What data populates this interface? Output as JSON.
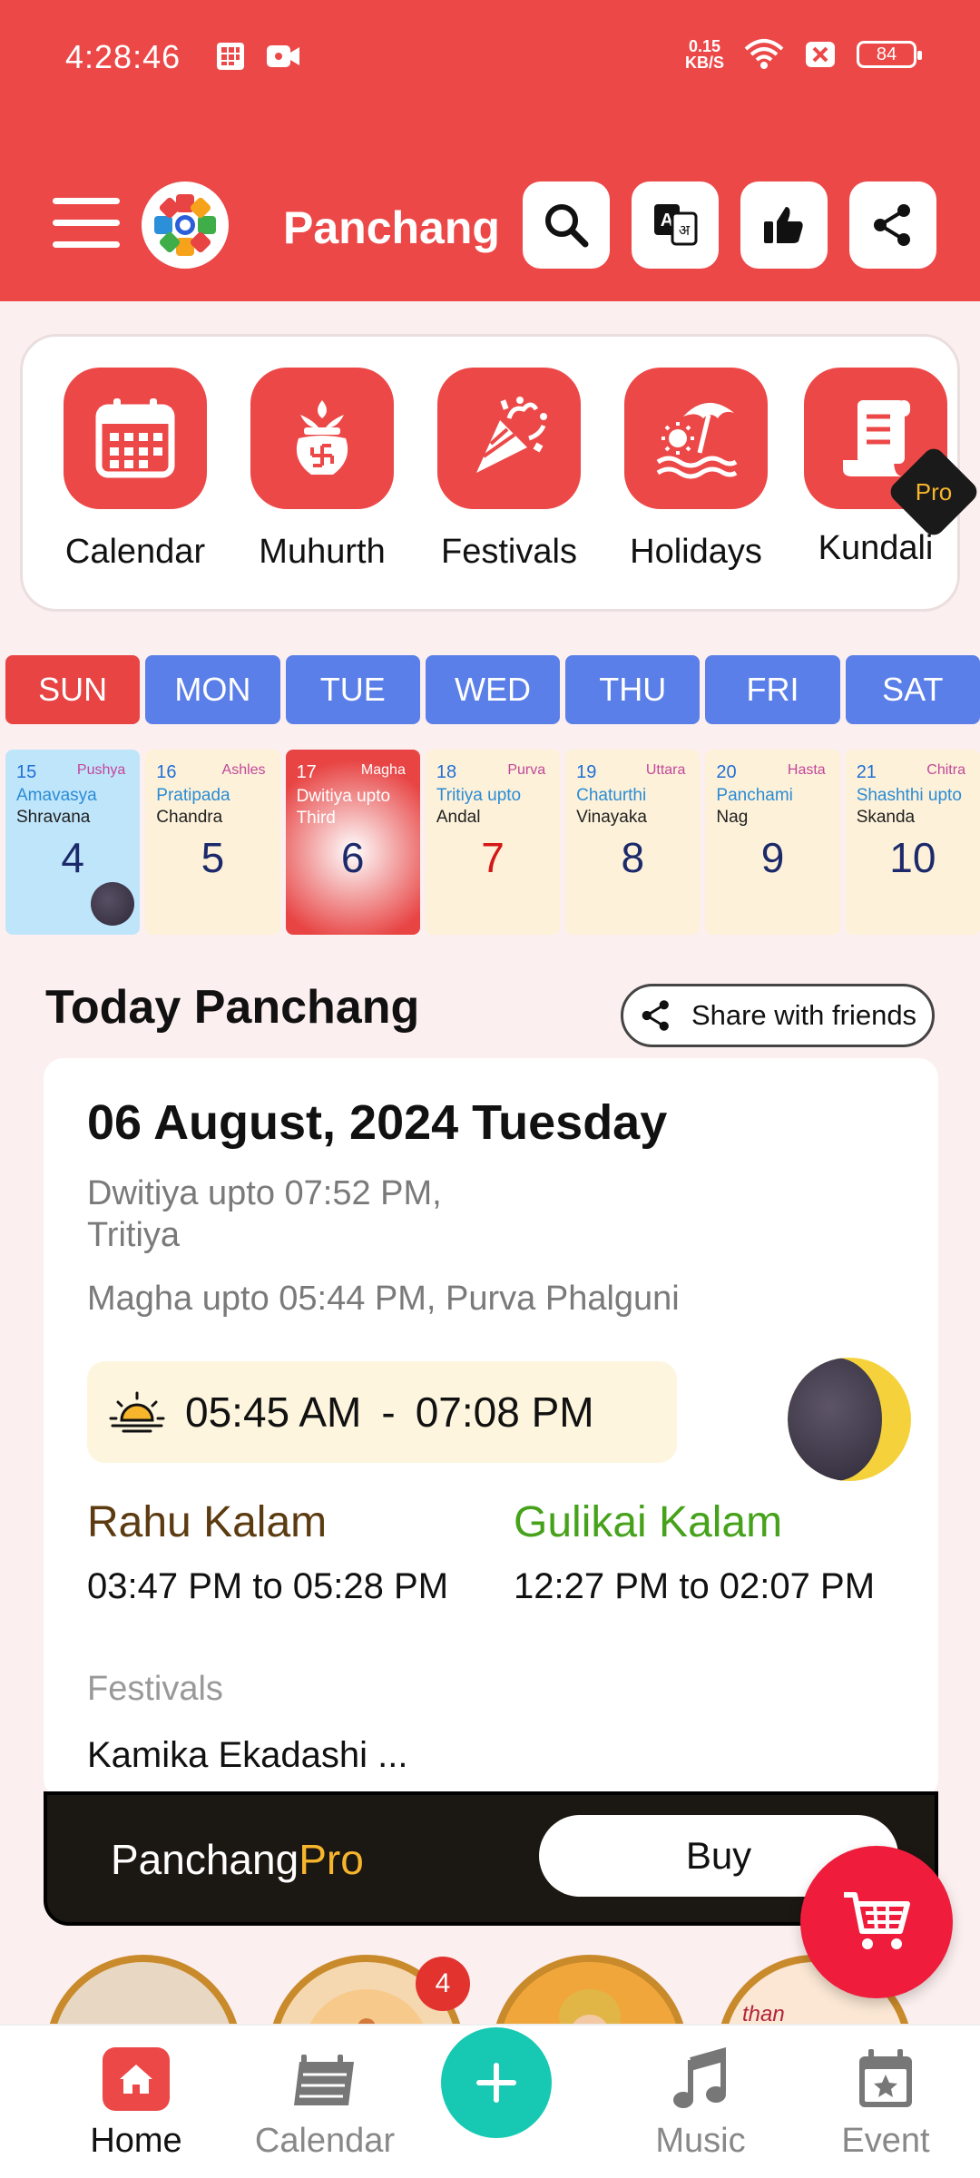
{
  "status_bar": {
    "time": "4:28:46",
    "net_speed_value": "0.15",
    "net_speed_unit": "KB/S",
    "battery": "84"
  },
  "app_bar": {
    "title": "Panchang"
  },
  "quick_menu": [
    {
      "label": "Calendar"
    },
    {
      "label": "Muhurth"
    },
    {
      "label": "Festivals"
    },
    {
      "label": "Holidays"
    },
    {
      "label": "Kundali",
      "badge": "Pro"
    }
  ],
  "week_days": [
    "SUN",
    "MON",
    "TUE",
    "WED",
    "THU",
    "FRI",
    "SAT"
  ],
  "dates": [
    {
      "small": "15",
      "nakshatra": "Pushya",
      "tithi": "Amavasya",
      "festival": "Shravana",
      "day": "4"
    },
    {
      "small": "16",
      "nakshatra": "Ashles",
      "tithi": "Pratipada",
      "festival": "Chandra",
      "day": "5"
    },
    {
      "small": "17",
      "nakshatra": "Magha",
      "tithi": "Dwitiya upto Third",
      "festival": "",
      "day": "6"
    },
    {
      "small": "18",
      "nakshatra": "Purva",
      "tithi": "Tritiya upto",
      "festival": "Andal",
      "day": "7"
    },
    {
      "small": "19",
      "nakshatra": "Uttara",
      "tithi": "Chaturthi",
      "festival": "Vinayaka",
      "day": "8"
    },
    {
      "small": "20",
      "nakshatra": "Hasta",
      "tithi": "Panchami",
      "festival": "Nag",
      "day": "9"
    },
    {
      "small": "21",
      "nakshatra": "Chitra",
      "tithi": "Shashthi upto",
      "festival": "Skanda",
      "day": "10"
    }
  ],
  "today": {
    "section_title": "Today Panchang",
    "share_label": "Share with friends",
    "date_line": "06 August, 2024 Tuesday",
    "tithi_line1": "Dwitiya upto 07:52 PM,",
    "tithi_line2": "Tritiya",
    "nakshatra_line": "Magha upto 05:44 PM, Purva Phalguni",
    "sunrise": "05:45 AM",
    "separator": "-",
    "sunset": "07:08 PM",
    "rahu_label": "Rahu Kalam",
    "rahu_time": "03:47 PM to 05:28 PM",
    "gulikai_label": "Gulikai Kalam",
    "gulikai_time": "12:27 PM to 02:07 PM",
    "festivals_label": "Festivals",
    "festivals_value": "Kamika Ekadashi ..."
  },
  "pro_banner": {
    "name_part1": "Panchang",
    "name_part2": "Pro",
    "buy_label": "Buy"
  },
  "stories": {
    "badge_count": "4",
    "story4_caption": "than"
  },
  "bottom_nav": [
    {
      "label": "Home",
      "active": true
    },
    {
      "label": "Calendar"
    },
    {
      "label": "Music"
    },
    {
      "label": "Event"
    }
  ],
  "colors": {
    "primary": "#ec4848",
    "weekday_blue": "#5b7fe8",
    "fab_teal": "#17c9b3",
    "cart_red": "#ef1c3c",
    "pro_gold": "#f7b52c"
  }
}
